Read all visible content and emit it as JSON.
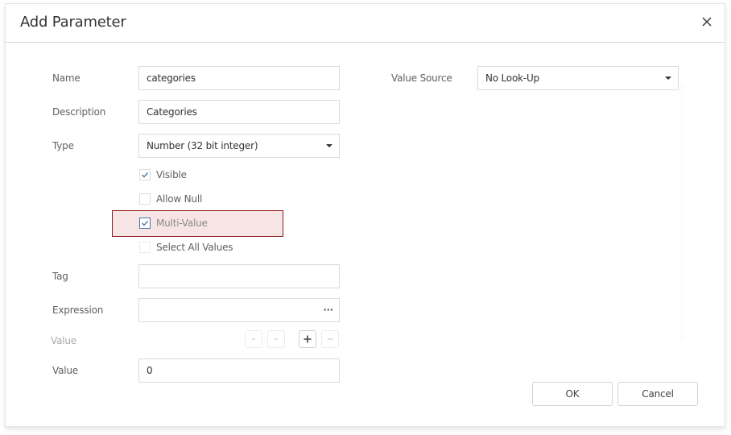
{
  "dialog": {
    "title": "Add Parameter",
    "close_icon": "close-icon"
  },
  "form": {
    "name": {
      "label": "Name",
      "value": "categories"
    },
    "description": {
      "label": "Description",
      "value": "Categories"
    },
    "type": {
      "label": "Type",
      "value": "Number (32 bit integer)"
    },
    "checkboxes": [
      {
        "label": "Visible",
        "checked": true
      },
      {
        "label": "Allow Null",
        "checked": false
      },
      {
        "label": "Multi-Value",
        "checked": true,
        "highlighted": true
      },
      {
        "label": "Select All Values",
        "checked": false,
        "disabled": true
      }
    ],
    "tag": {
      "label": "Tag",
      "value": ""
    },
    "expression": {
      "label": "Expression",
      "value": "",
      "ellipsis": "···"
    },
    "values_section": {
      "label": "Value",
      "buttons": [
        "move-up",
        "move-down",
        "add",
        "remove"
      ]
    },
    "value": {
      "label": "Value",
      "value": "0"
    },
    "value_source": {
      "label": "Value Source",
      "value": "No Look-Up"
    }
  },
  "footer": {
    "ok_label": "OK",
    "cancel_label": "Cancel"
  },
  "colors": {
    "highlight_fill": "#f7e4e4",
    "highlight_border": "#8b1a1a",
    "checkbox_accent": "#4a76a8"
  }
}
